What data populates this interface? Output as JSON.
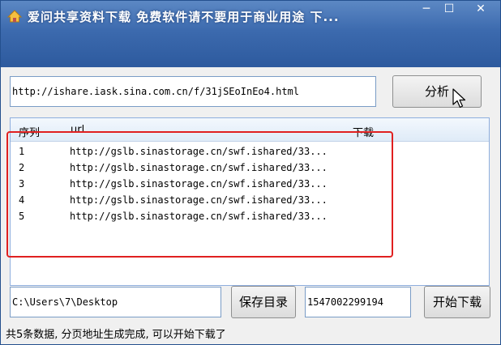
{
  "window": {
    "title": "爱问共享资料下载 免费软件请不要用于商业用途 下...",
    "min_icon": "─",
    "max_icon": "☐",
    "close_icon": "✕"
  },
  "url_input": {
    "value": "http://ishare.iask.sina.com.cn/f/31jSEoInEo4.html"
  },
  "analyze_button": {
    "label": "分析"
  },
  "list": {
    "columns": [
      "序列",
      "url",
      "下载"
    ],
    "rows": [
      {
        "index": "1",
        "url": "http://gslb.sinastorage.cn/swf.ishared/33...",
        "download": ""
      },
      {
        "index": "2",
        "url": "http://gslb.sinastorage.cn/swf.ishared/33...",
        "download": ""
      },
      {
        "index": "3",
        "url": "http://gslb.sinastorage.cn/swf.ishared/33...",
        "download": ""
      },
      {
        "index": "4",
        "url": "http://gslb.sinastorage.cn/swf.ishared/33...",
        "download": ""
      },
      {
        "index": "5",
        "url": "http://gslb.sinastorage.cn/swf.ishared/33...",
        "download": ""
      }
    ]
  },
  "path_input": {
    "value": "C:\\Users\\7\\Desktop"
  },
  "save_dir_button": {
    "label": "保存目录"
  },
  "id_input": {
    "value": "1547002299194"
  },
  "start_button": {
    "label": "开始下载"
  },
  "status": {
    "text": "共5条数据, 分页地址生成完成, 可以开始下载了"
  },
  "colors": {
    "title_bar": "#3c6aae",
    "highlight": "#e02020"
  }
}
